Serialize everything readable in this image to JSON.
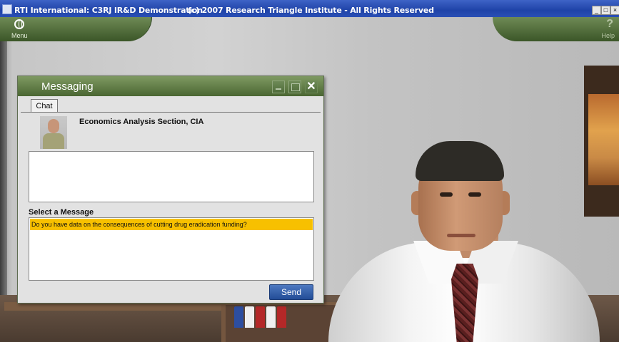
{
  "window": {
    "title": "RTI International: C3RJ IR&D Demonstration",
    "copyright": "(c) 2007 Research Triangle Institute - All Rights Reserved",
    "controls": {
      "minimize": "_",
      "maximize": "□",
      "close": "×"
    }
  },
  "topbar": {
    "menu_label": "Menu",
    "menu_icon": "globe-icon",
    "help_label": "Help",
    "help_icon": "question-icon",
    "accent": "#4a6632"
  },
  "messaging": {
    "title": "Messaging",
    "tab_chat": "Chat",
    "contact_name": "Economics Analysis Section, CIA",
    "select_label": "Select a Message",
    "messages": [
      "Do you have data on the consequences of cutting drug eradication funding?"
    ],
    "selected_color": "#f7c000",
    "send_label": "Send",
    "close_glyph": "✕"
  }
}
